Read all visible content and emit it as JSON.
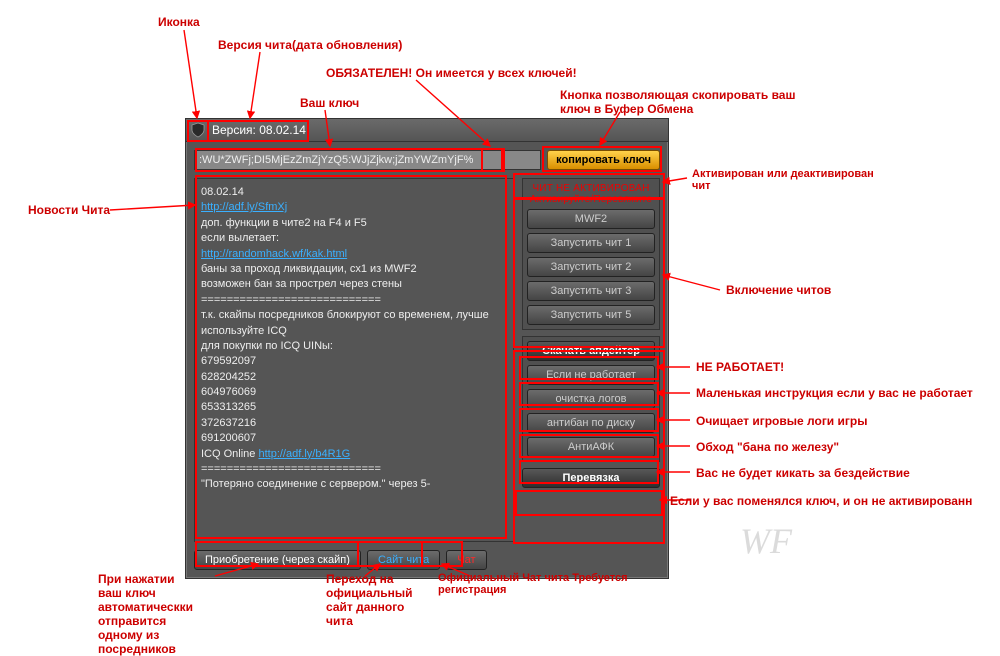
{
  "titlebar": {
    "version_label": "Версия: 08.02.14"
  },
  "key": {
    "value": ":WU*ZWFj;DI5MjEzZmZjYzQ5:WJjZjkw;jZmYWZmYjF%"
  },
  "buttons": {
    "copy_key": "копировать ключ",
    "mwf2": "MWF2",
    "run1": "Запустить чит 1",
    "run2": "Запустить чит 2",
    "run3": "Запустить чит 3",
    "run5": "Запустить чит 5",
    "updater": "Скачать апдейтер",
    "if_broken": "Если не работает",
    "clear_logs": "очистка логов",
    "antiban": "антибан по диску",
    "antiafk": "АнтиАФК",
    "rebind": "Перевязка",
    "buy": "Приобретение (через скайп)",
    "site": "Сайт чита",
    "chat": "Чат"
  },
  "box_titles": {
    "cheats": "ЧИТ НЕ АКТИВИРОВАН\nАктивируйте/Перевяжите"
  },
  "news": {
    "date": "08.02.14",
    "link1": "http://adf.ly/SfmXj",
    "l1": "доп. функции в чите2 на F4 и F5",
    "l2": "если вылетает:",
    "link2": "http://randomhack.wf/kak.html",
    "l3": "баны за проход ликвидации, cx1 из MWF2",
    "l4": "возможен бан за прострел через стены",
    "sep1": "============================",
    "l5": "т.к. скайпы посредников блокируют со временем, лучше используйте ICQ",
    "l6": "для покупки по ICQ UINы:",
    "uin1": "679592097",
    "uin2": "628204252",
    "uin3": "604976069",
    "uin4": "653313265",
    "uin5": "372637216",
    "uin6": "691200607",
    "l7a": "ICQ Online ",
    "link3": "http://adf.ly/b4R1G",
    "sep2": "============================",
    "l8": "\"Потеряно соединение с сервером.\" через 5-"
  },
  "annotations": {
    "icon": "Иконка",
    "version": "Версия чита(дата обновления)",
    "key_required": "ОБЯЗАТЕЛЕН! Он имеется у всех ключей!",
    "your_key": "Ваш ключ",
    "copy_hint": "Кнопка позволяющая скопировать ваш\nключ в Буфер Обмена",
    "news_label": "Новости Чита",
    "activate_hint": "Активирован или деактивирован\nчит",
    "enable_cheats": "Включение читов",
    "not_works": "НЕ РАБОТАЕТ!",
    "small_instr": "Маленькая инструкция если у вас не работает",
    "clear_logs_hint": "Очищает игровые логи игры",
    "antiban_hint": "Обход \"бана по железу\"",
    "antiafk_hint": "Вас не будет кикать за бездействие",
    "rebind_hint": "Если у вас поменялся ключ, и он не активированн",
    "buy_hint": "При нажатии\nваш ключ\nавтоматическки\nотправится\nодному из\nпосредников",
    "site_hint": "Переход на\nофициальный\nсайт данного\nчита",
    "chat_hint": "Официальный Чат чита Требуется\nрегистрация"
  },
  "watermark": "WF"
}
